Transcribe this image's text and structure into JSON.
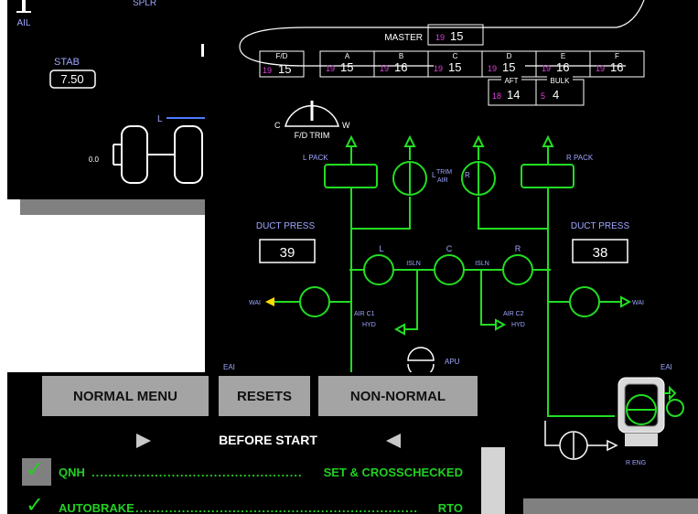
{
  "flight_controls": {
    "ail_label": "AIL",
    "splr_label": "SPLR",
    "stab_label": "STAB",
    "stab_value": "7.50",
    "l_label": "L",
    "zero_label": "0.0"
  },
  "air_synoptic": {
    "master_label": "MASTER",
    "master_set": "19",
    "master_actual": "15",
    "fd_label": "F/D",
    "fd_set": "19",
    "fd_actual": "15",
    "zones": [
      {
        "label": "A",
        "set": "19",
        "actual": "15"
      },
      {
        "label": "B",
        "set": "19",
        "actual": "16"
      },
      {
        "label": "C",
        "set": "19",
        "actual": "15"
      },
      {
        "label": "D",
        "set": "19",
        "actual": "15"
      },
      {
        "label": "E",
        "set": "19",
        "actual": "16"
      },
      {
        "label": "F",
        "set": "19",
        "actual": "16"
      }
    ],
    "aft_label": "AFT",
    "aft_set": "18",
    "aft_actual": "14",
    "bulk_label": "BULK",
    "bulk_set": "5",
    "bulk_actual": "4",
    "fd_trim_label": "F/D TRIM",
    "c_label": "C",
    "w_label": "W",
    "l_pack_label": "L PACK",
    "r_pack_label": "R PACK",
    "trim_air_l": "L",
    "trim_air_label": "TRIM\nAIR",
    "trim_air_r": "R",
    "duct_press_label": "DUCT PRESS",
    "left_duct_press": "39",
    "right_duct_press": "38",
    "isln_label": "ISLN",
    "l_label": "L",
    "c_label2": "C",
    "r_label": "R",
    "wai_label": "WAI",
    "air_c1_label": "AIR C1",
    "air_c2_label": "AIR C2",
    "hyd_label": "HYD",
    "apu_label": "APU",
    "eai_label": "EAI",
    "r_eng_label": "R ENG"
  },
  "checklist": {
    "menu_buttons": [
      "NORMAL MENU",
      "RESETS",
      "NON-NORMAL"
    ],
    "title": "BEFORE START",
    "items": [
      {
        "label": "QNH",
        "value": "SET & CROSSCHECKED"
      },
      {
        "label": "AUTOBRAKE",
        "value": "RTO"
      }
    ],
    "colors": {
      "item_green": "#22d022",
      "button_gray": "#a4a4a4",
      "line_green": "#22dd22",
      "label_blue": "#9fa7ff",
      "magenta": "#e040e0"
    }
  }
}
